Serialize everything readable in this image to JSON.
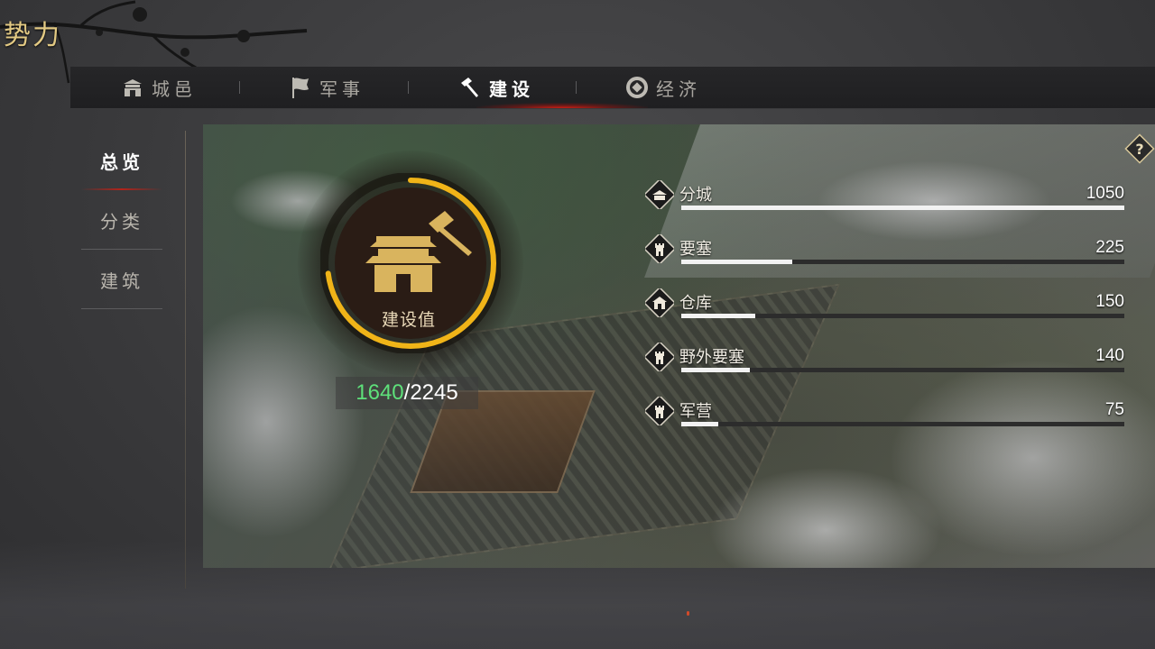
{
  "page_title": "势力",
  "tabs": [
    {
      "label": "城邑",
      "icon": "city-gate-icon",
      "active": false
    },
    {
      "label": "军事",
      "icon": "flag-icon",
      "active": false
    },
    {
      "label": "建设",
      "icon": "hammer-icon",
      "active": true
    },
    {
      "label": "经济",
      "icon": "coin-icon",
      "active": false
    }
  ],
  "side_nav": [
    {
      "label": "总览",
      "active": true
    },
    {
      "label": "分类",
      "active": false
    },
    {
      "label": "建筑",
      "active": false
    }
  ],
  "badge": {
    "label": "建设值",
    "icon": "palace-hammer-icon",
    "current": "1640",
    "separator": "/",
    "max": "2245",
    "progress": 0.73
  },
  "stats": [
    {
      "name": "分城",
      "value": "1050",
      "fill": 1.0,
      "icon": "sub-city-icon"
    },
    {
      "name": "要塞",
      "value": "225",
      "fill": 0.25,
      "icon": "tower-icon"
    },
    {
      "name": "仓库",
      "value": "150",
      "fill": 0.167,
      "icon": "warehouse-icon"
    },
    {
      "name": "野外要塞",
      "value": "140",
      "fill": 0.155,
      "icon": "tower-icon"
    },
    {
      "name": "军营",
      "value": "75",
      "fill": 0.083,
      "icon": "tower-icon"
    }
  ],
  "help_icon": "question-icon",
  "colors": {
    "accent_gold": "#e2c983",
    "progress_green": "#5ee07a",
    "tab_glow_red": "#d21e14",
    "ring_gold": "#f0b418"
  }
}
